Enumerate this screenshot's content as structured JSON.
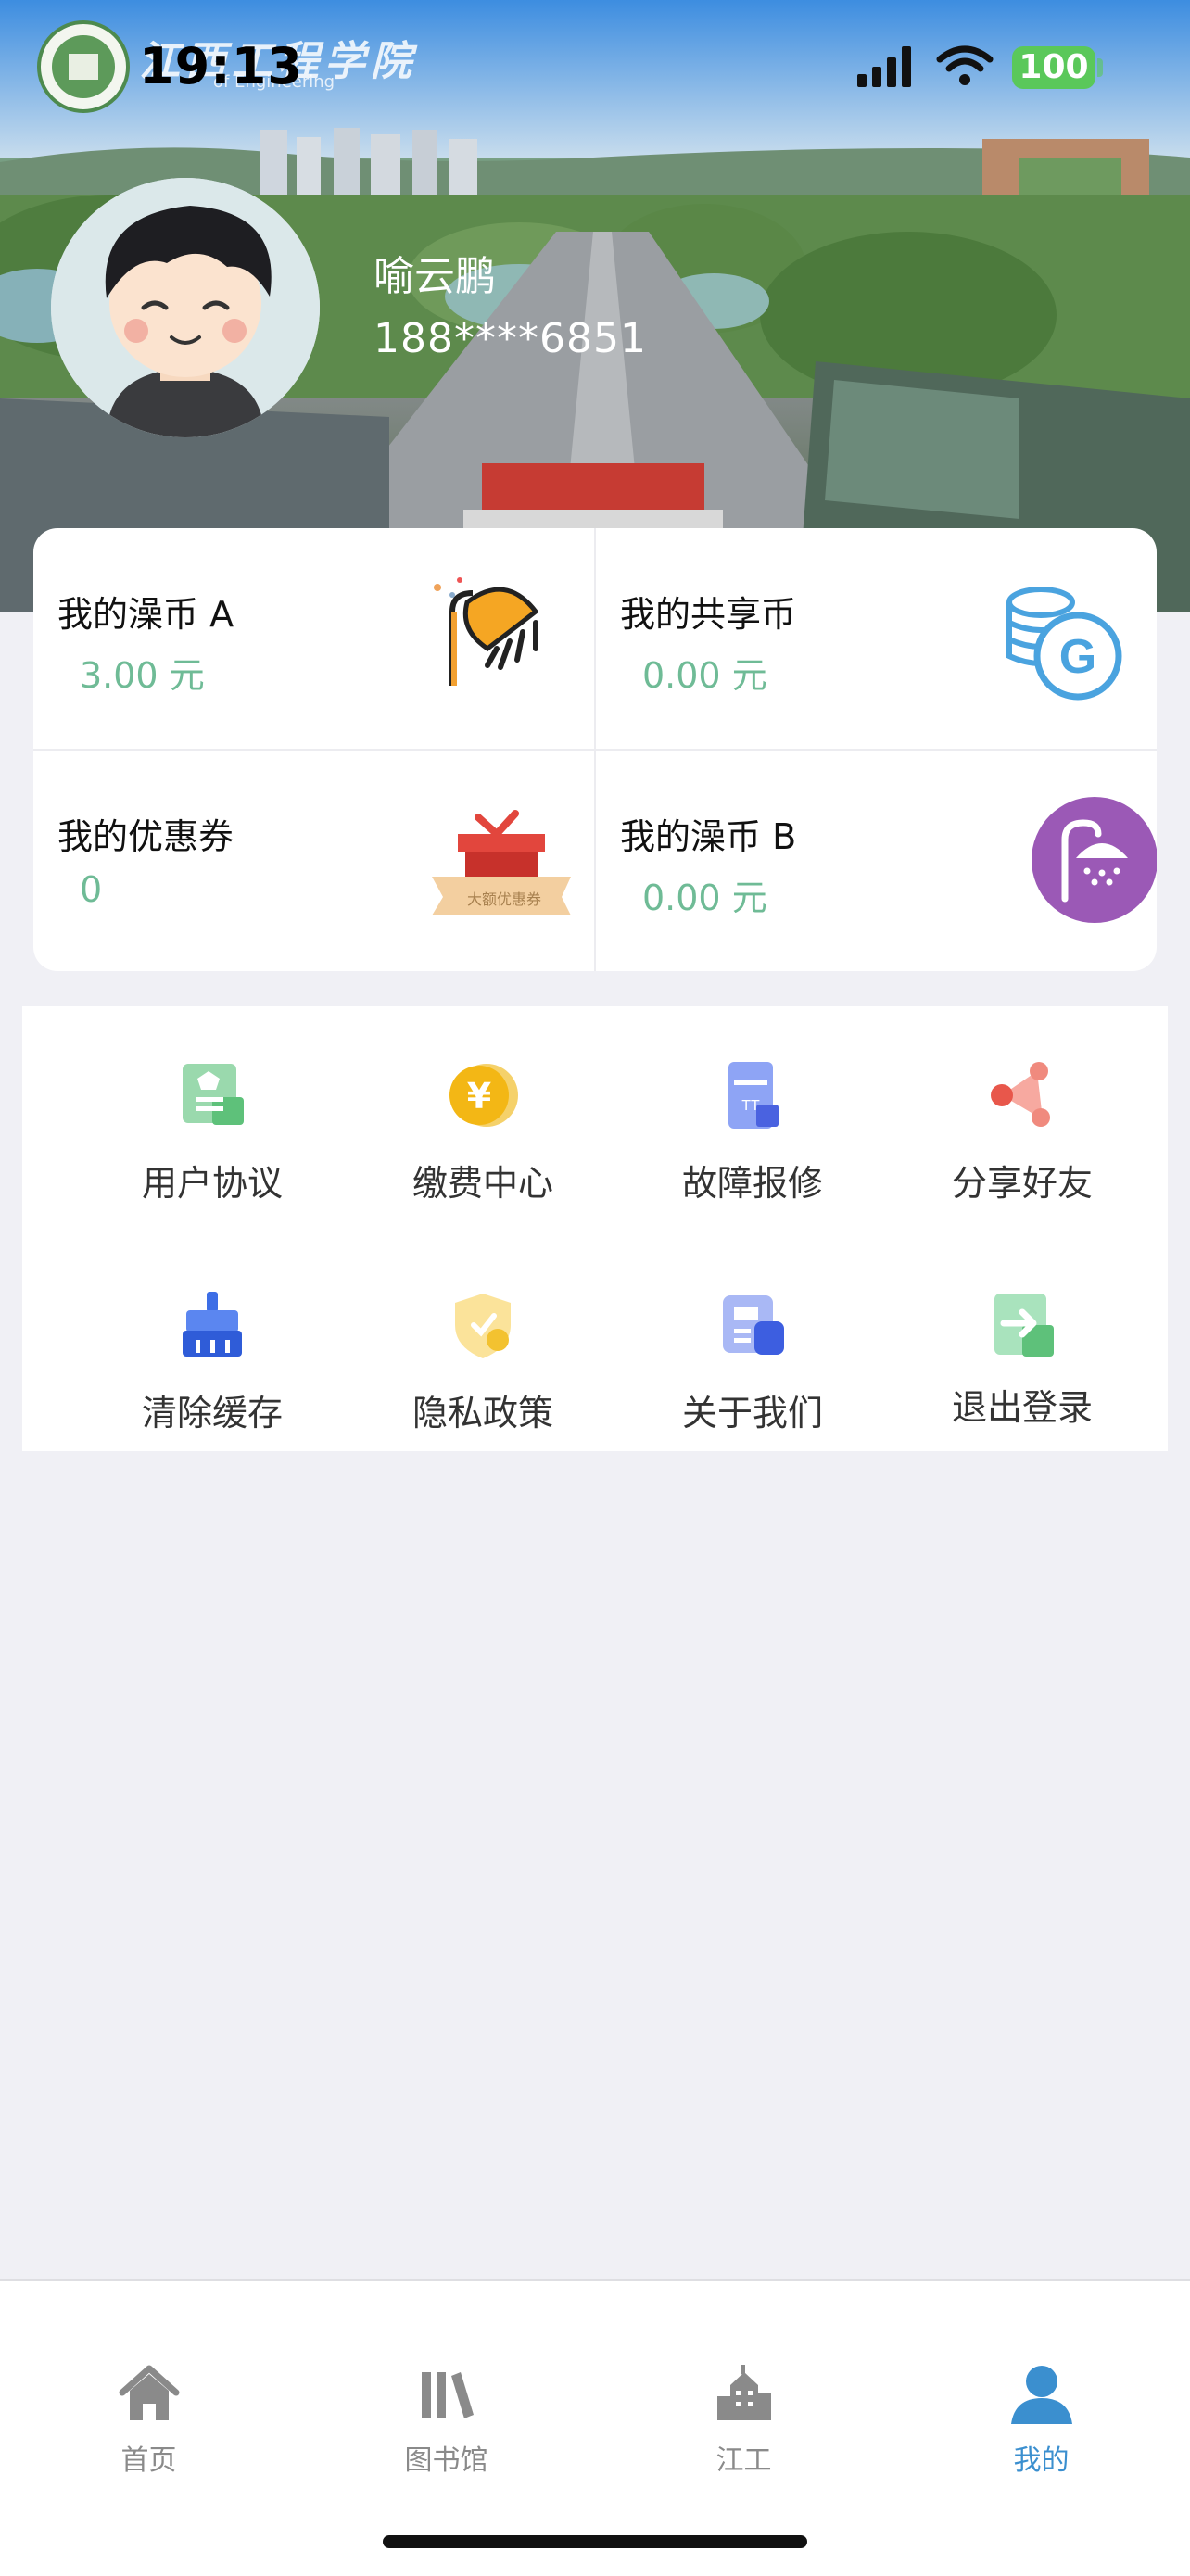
{
  "status_bar": {
    "time": "19:13",
    "battery": "100"
  },
  "header": {
    "school_name": "江西工程学院",
    "school_subtitle": "of Engineering",
    "user_name": "喻云鹏",
    "user_phone": "188****6851"
  },
  "wallet": {
    "items": [
      {
        "label": "我的澡币 A",
        "value": "3.00 元",
        "icon": "shower-head-icon"
      },
      {
        "label": "我的共享币",
        "value": "0.00 元",
        "icon": "coin-stack-g-icon"
      },
      {
        "label": "我的优惠券",
        "value": "0",
        "icon": "gift-coupon-icon",
        "badge": "大额优惠券"
      },
      {
        "label": "我的澡币 B",
        "value": "0.00 元",
        "icon": "shower-purple-icon"
      }
    ]
  },
  "menu": {
    "items": [
      {
        "label": "用户协议",
        "icon": "agreement-icon"
      },
      {
        "label": "缴费中心",
        "icon": "yen-coin-icon"
      },
      {
        "label": "故障报修",
        "icon": "repair-ticket-icon"
      },
      {
        "label": "分享好友",
        "icon": "share-icon"
      },
      {
        "label": "清除缓存",
        "icon": "broom-icon"
      },
      {
        "label": "隐私政策",
        "icon": "shield-icon"
      },
      {
        "label": "关于我们",
        "icon": "save-disk-icon"
      },
      {
        "label": "退出登录",
        "icon": "logout-icon"
      }
    ]
  },
  "tabbar": {
    "items": [
      {
        "label": "首页",
        "icon": "home-icon"
      },
      {
        "label": "图书馆",
        "icon": "library-icon"
      },
      {
        "label": "江工",
        "icon": "building-icon"
      },
      {
        "label": "我的",
        "icon": "user-icon"
      }
    ],
    "active": "我的"
  },
  "colors": {
    "accent": "#3b8fcf",
    "value_green": "#6fbb96",
    "battery_green": "#5ac85a"
  }
}
